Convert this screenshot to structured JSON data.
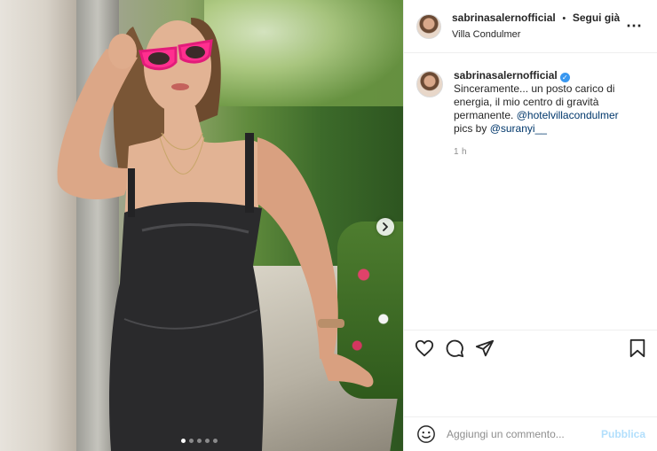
{
  "post": {
    "author": {
      "username": "sabrinasalernofficial",
      "follow_label": "Segui già",
      "location": "Villa Condulmer",
      "verified": true
    },
    "caption": {
      "username": "sabrinasalernofficial",
      "text": "Sinceramente... un posto carico di energia, il mio centro di gravità permanente.",
      "mention1": "@hotelvillacondulmer",
      "pics_by_label": "pics by",
      "mention2": "@suranyi__",
      "time": "1 h"
    },
    "carousel": {
      "total_slides": 5,
      "active_index": 0
    },
    "actions": {
      "like_icon": "heart-icon",
      "comment_icon": "comment-icon",
      "share_icon": "share-icon",
      "save_icon": "bookmark-icon"
    },
    "comment_box": {
      "placeholder": "Aggiungi un commento...",
      "publish_label": "Pubblica"
    },
    "colors": {
      "mention": "#00376b",
      "verified": "#3897f0",
      "publish_disabled": "#b2dffc",
      "secondary_text": "#8e8e8e"
    }
  }
}
